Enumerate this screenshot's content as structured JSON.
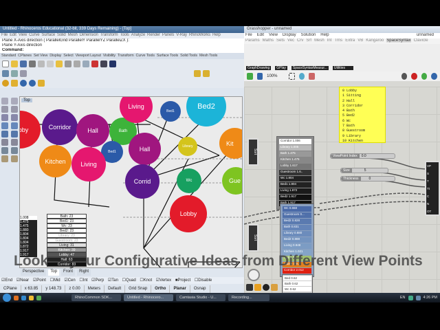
{
  "rhino": {
    "title": "Untitled - Rhinoceros Educational (32-bit, 339 Days Remaining) - [Top]",
    "menu": [
      "File",
      "Edit",
      "View",
      "Curve",
      "Surface",
      "Solid",
      "Mesh",
      "Dimension",
      "Transform",
      "Tools",
      "Analyze",
      "Render",
      "Panels",
      "V-Ray",
      "RhinoWorks",
      "Help"
    ],
    "cmd_lines": [
      "Plane X-Axis direction ( ParallelGrid  ParallelY  ParallelYZ  ParallelZX ):",
      "Plane Y-Axis direction"
    ],
    "command_label": "Command:",
    "toolbar_tabs": [
      "Standard",
      "CPlanes",
      "Set View",
      "Display",
      "Select",
      "Viewport Layout",
      "Visibility",
      "Transform",
      "Curve Tools",
      "Surface Tools",
      "Solid Tools",
      "Mesh Tools"
    ],
    "viewport_label": "Top",
    "bubbles_left": [
      "Lobby",
      "Corridor",
      "Hall",
      "Bath",
      "Bed1",
      "Kitchen",
      "Living"
    ],
    "bubbles_right": [
      "Living",
      "Bed1",
      "Bed2",
      "Hall",
      "Library",
      "Kit",
      "Corrid",
      "Wc",
      "Gue",
      "Lobby"
    ],
    "dark_values": [
      "1.008",
      "1.475",
      "1.475",
      "1.880",
      "1.804",
      "1.804",
      "1.804",
      "1.872",
      "1.917",
      "1.917"
    ],
    "table_rows": [
      "Bath: 23",
      "Bed1: 23",
      "Wc: 23",
      "Bed2: 23",
      "Library: 23",
      "Guestroom: 23",
      "Living: 31",
      "Kitchen: 39",
      "Lobby: 47",
      "Hall: 63",
      "Corridor: 83"
    ],
    "view_tabs": [
      "Perspective",
      "Top",
      "Front",
      "Right"
    ],
    "osnaps": [
      "End",
      "Near",
      "Point",
      "Mid",
      "Cen",
      "Int",
      "Perp",
      "Tan",
      "Quad",
      "Knot",
      "Vertex",
      "Project",
      "Disable"
    ],
    "status": [
      "CPlane",
      "x 63.85",
      "y 148.73",
      "z 0.00",
      "Meters",
      "Default",
      "Grid Snap",
      "Ortho",
      "Planar",
      "Osnap"
    ]
  },
  "gh": {
    "title": "Grasshopper - unnamed",
    "window_buttons": "unnamed",
    "menu": [
      "File",
      "Edit",
      "View",
      "Display",
      "Solution",
      "Help"
    ],
    "tabs": [
      "Params",
      "Maths",
      "Sets",
      "Vec",
      "Crv",
      "Srf",
      "Mesh",
      "Int",
      "Trns",
      "Extra",
      "VB",
      "Kangaroo",
      "SpaceSyntax",
      "Clavicle"
    ],
    "groups": [
      "GraphDrawing",
      "GPlay",
      "SpaceSyntaxMeasur...",
      "Utilities"
    ],
    "zoom": "100%",
    "yellow_panel": [
      "0 Lobby",
      "1 Sitting",
      "2 Hall",
      "3 Corridor",
      "4 Bath",
      "5 Bed2",
      "6 Wc",
      "7 Bath",
      "8 Guestroom",
      "9 Library",
      "10 Kitchen"
    ],
    "list1": [
      "Corridor 1.006",
      "Library 1.005",
      "Bath 1.475",
      "Kitchen 1.475",
      "Lobby 1.617",
      "Guestroom 1.6..",
      "Wc 1.804",
      "Bed1 1.804",
      "Living 1.872",
      "Bed2 1.917",
      "Bath 1.917"
    ],
    "list2": [
      "Wc 0.658",
      "Guestroom 0...",
      "Bed2 0.828",
      "Bath 0.831",
      "Library 0.880",
      "Bed2 0.888",
      "Living 0.948",
      "Kitchen 1.021",
      "Hall 1.6..",
      "Lobby 1.9..",
      "Corridor 2.012"
    ],
    "list3": [
      "Bed 0.62",
      "Bath 0.62",
      "Wc 0.62"
    ],
    "slider1": {
      "label": "ViewPoint Index",
      "value": "0.0"
    },
    "slider2": {
      "label": "Size",
      "value": "5"
    },
    "slider3": {
      "label": "Thickness",
      "value": "0"
    },
    "sort_label": "Sort",
    "node_inputs": [
      "VP",
      "S",
      "T",
      "Tt",
      "C",
      "N",
      "OT"
    ]
  },
  "overlay": "Look at your Configurative Ideas from Different View Points",
  "taskbar": {
    "items": [
      "RhinoCommon SDK...",
      "Untitled - Rhinocero...",
      "Camtasia Studio - U...",
      "Recording..."
    ],
    "lang": "EN",
    "time": "4:26 PM"
  }
}
